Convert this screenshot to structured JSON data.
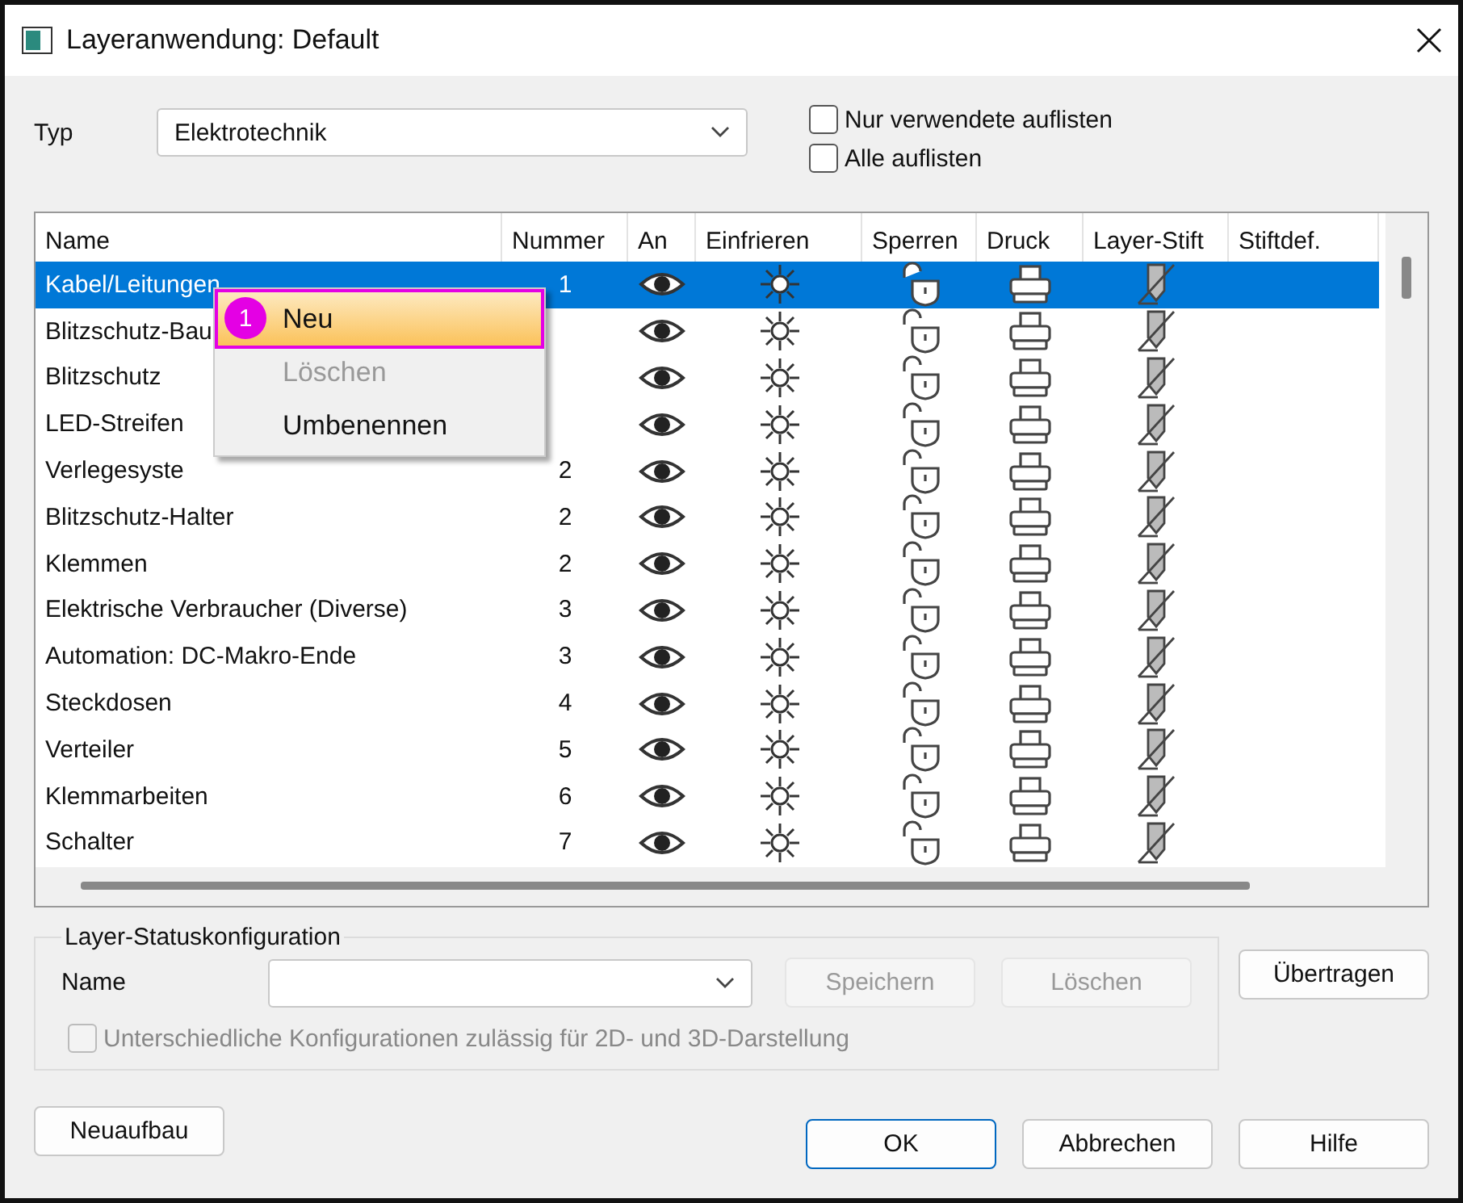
{
  "window": {
    "title": "Layeranwendung: Default"
  },
  "type_field": {
    "label": "Typ",
    "value": "Elektrotechnik"
  },
  "filters": [
    {
      "label": "Nur verwendete auflisten",
      "checked": false
    },
    {
      "label": "Alle auflisten",
      "checked": false
    }
  ],
  "table": {
    "columns": [
      "Name",
      "Nummer",
      "An",
      "Einfrieren",
      "Sperren",
      "Druck",
      "Layer-Stift",
      "Stiftdef."
    ],
    "rows": [
      {
        "name": "Kabel/Leitungen",
        "number": "1",
        "selected": true
      },
      {
        "name": "Blitzschutz-Bau",
        "selected": false
      },
      {
        "name": "Blitzschutz",
        "selected": false
      },
      {
        "name": "LED-Streifen",
        "selected": false
      },
      {
        "name": "Verlegesyste",
        "number": "2",
        "selected": false
      },
      {
        "name": "Blitzschutz-Halter",
        "number": "2",
        "selected": false
      },
      {
        "name": "Klemmen",
        "number": "2",
        "selected": false
      },
      {
        "name": "Elektrische Verbraucher (Diverse)",
        "number": "3",
        "selected": false
      },
      {
        "name": "Automation: DC-Makro-Ende",
        "number": "3",
        "selected": false
      },
      {
        "name": "Steckdosen",
        "number": "4",
        "selected": false
      },
      {
        "name": "Verteiler",
        "number": "5",
        "selected": false
      },
      {
        "name": "Klemmarbeiten",
        "number": "6",
        "selected": false
      },
      {
        "name": "Schalter",
        "number": "7",
        "selected": false
      }
    ]
  },
  "context_menu": {
    "badge": "1",
    "items": [
      {
        "label": "Neu",
        "selected": true,
        "disabled": false
      },
      {
        "label": "Löschen",
        "selected": false,
        "disabled": true
      },
      {
        "label": "Umbenennen",
        "selected": false,
        "disabled": false
      }
    ]
  },
  "status_config": {
    "title": "Layer-Statuskonfiguration",
    "name_label": "Name",
    "buttons": [
      {
        "label": "Speichern",
        "disabled": true
      },
      {
        "label": "Löschen",
        "disabled": true
      }
    ],
    "option": {
      "label": "Unterschiedliche Konfigurationen zulässig für 2D- und 3D-Darstellung",
      "checked": false,
      "disabled": true
    }
  },
  "transfer_button": "Übertragen",
  "rebuild_button": "Neuaufbau",
  "buttons": [
    {
      "label": "OK",
      "default": true
    },
    {
      "label": "Abbrechen",
      "default": false
    },
    {
      "label": "Hilfe",
      "default": false
    }
  ]
}
